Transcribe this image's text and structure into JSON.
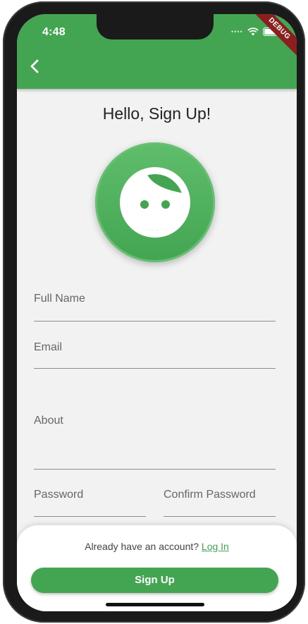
{
  "status_bar": {
    "time": "4:48",
    "debug_label": "DEBUG"
  },
  "page": {
    "title": "Hello, Sign Up!"
  },
  "form": {
    "full_name_label": "Full Name",
    "email_label": "Email",
    "about_label": "About",
    "password_label": "Password",
    "confirm_password_label": "Confirm Password"
  },
  "footer": {
    "have_account_text": "Already have an account?",
    "login_link": "Log In",
    "signup_button": "Sign Up"
  },
  "icons": [
    "back-icon",
    "wifi-icon",
    "battery-icon",
    "face-icon"
  ],
  "colors": {
    "primary": "#43a451",
    "background": "#f2f2f2",
    "debug": "#8b1f1f"
  }
}
